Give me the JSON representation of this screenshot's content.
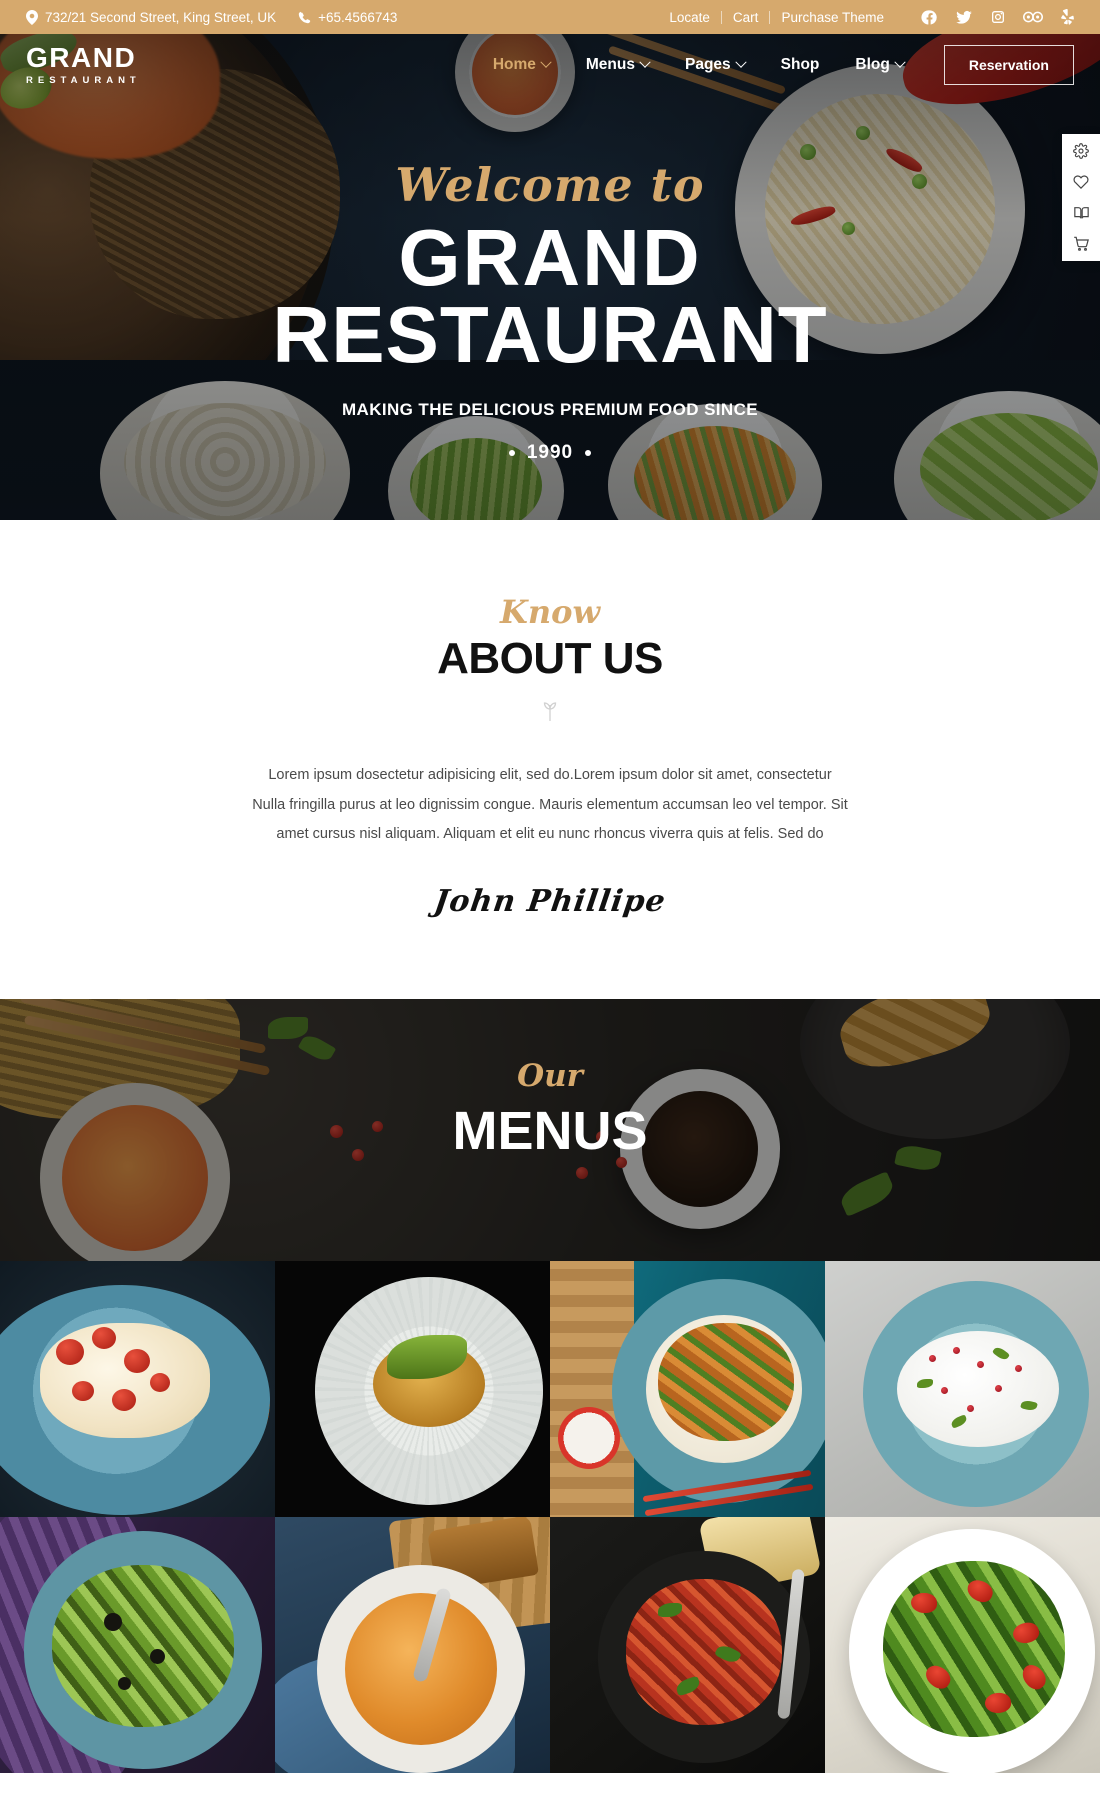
{
  "topbar": {
    "address": "732/21 Second Street, King Street, UK",
    "phone": "+65.4566743",
    "links": [
      {
        "label": "Locate"
      },
      {
        "label": "Cart"
      },
      {
        "label": "Purchase Theme"
      }
    ],
    "social": [
      {
        "name": "facebook-icon"
      },
      {
        "name": "twitter-icon"
      },
      {
        "name": "instagram-icon"
      },
      {
        "name": "tripadvisor-icon"
      },
      {
        "name": "yelp-icon"
      }
    ],
    "background_color": "#d6a96d"
  },
  "nav": {
    "logo_main": "GRAND",
    "logo_sub": "RESTAURANT",
    "items": [
      {
        "label": "Home",
        "has_dropdown": true,
        "active": true
      },
      {
        "label": "Menus",
        "has_dropdown": true,
        "active": false
      },
      {
        "label": "Pages",
        "has_dropdown": true,
        "active": false
      },
      {
        "label": "Shop",
        "has_dropdown": false,
        "active": false
      },
      {
        "label": "Blog",
        "has_dropdown": true,
        "active": false
      }
    ],
    "cta_label": "Reservation",
    "active_color": "#d6a96d"
  },
  "hero": {
    "script": "Welcome to",
    "title_line1": "GRAND",
    "title_line2": "RESTAURANT",
    "tagline": "MAKING THE DELICIOUS PREMIUM FOOD SINCE",
    "year": "1990",
    "accent_color": "#d6a96d"
  },
  "dock": [
    {
      "name": "gear-icon",
      "label": "Settings"
    },
    {
      "name": "heart-icon",
      "label": "Wishlist"
    },
    {
      "name": "book-icon",
      "label": "Menu Book"
    },
    {
      "name": "cart-icon",
      "label": "Cart"
    }
  ],
  "about": {
    "eyebrow": "Know",
    "title": "ABOUT US",
    "body": "Lorem ipsum dosectetur adipisicing elit, sed do.Lorem ipsum dolor sit amet, consectetur Nulla fringilla purus at leo dignissim congue. Mauris elementum accumsan leo vel tempor. Sit amet cursus nisl aliquam. Aliquam et elit eu nunc rhoncus viverra quis at felis. Sed do",
    "signature": "John Phillipe"
  },
  "menus": {
    "eyebrow": "Our",
    "title": "MENUS"
  },
  "gallery": {
    "items": [
      {
        "name": "gallery-item-bruschetta"
      },
      {
        "name": "gallery-item-plated-dish"
      },
      {
        "name": "gallery-item-stirfry-rice"
      },
      {
        "name": "gallery-item-burrata-pomegranate"
      },
      {
        "name": "gallery-item-garden-salad"
      },
      {
        "name": "gallery-item-pumpkin-soup"
      },
      {
        "name": "gallery-item-spaghetti-bolognese"
      },
      {
        "name": "gallery-item-arugula-strawberry-salad"
      }
    ]
  }
}
